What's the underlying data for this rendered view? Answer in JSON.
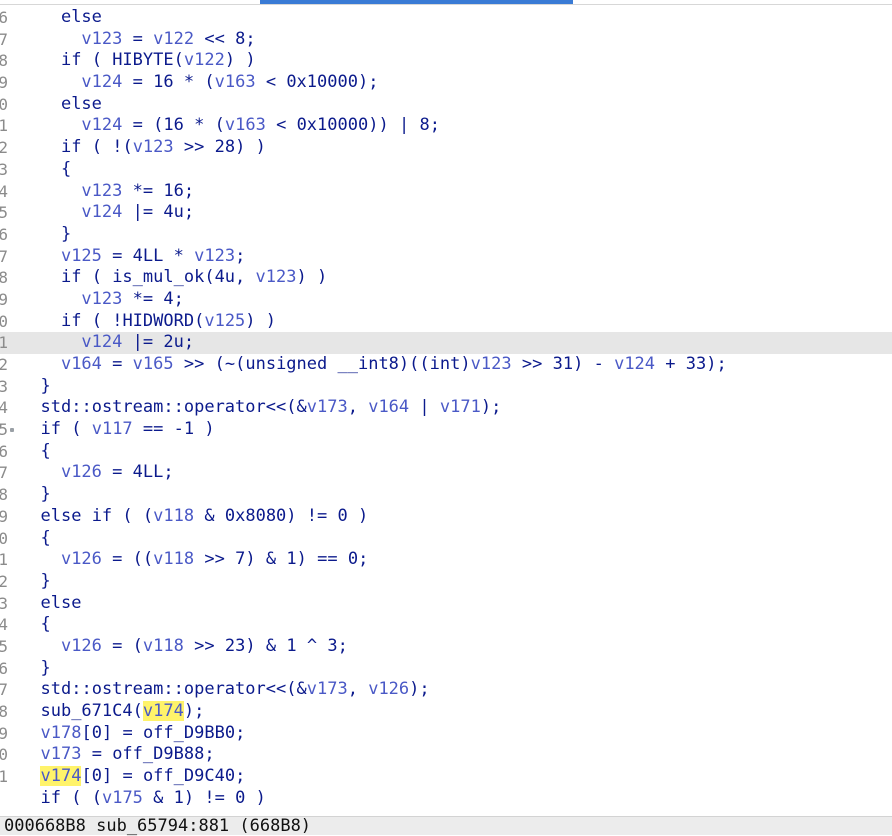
{
  "editor": {
    "line_prefixes": [
      "6",
      "7",
      "8",
      "9",
      "0",
      "1",
      "2",
      "3",
      "4",
      "5",
      "6",
      "7",
      "8",
      "9",
      "0",
      "1",
      "2",
      "3",
      "4",
      "5",
      "6",
      "7",
      "8",
      "9",
      "0",
      "1",
      "2",
      "3",
      "4",
      "5",
      "6",
      "7",
      "8",
      "9",
      "0",
      "1"
    ],
    "lines": [
      "    else",
      "      v123 = v122 << 8;",
      "    if ( HIBYTE(v122) )",
      "      v124 = 16 * (v163 < 0x10000);",
      "    else",
      "      v124 = (16 * (v163 < 0x10000)) | 8;",
      "    if ( !(v123 >> 28) )",
      "    {",
      "      v123 *= 16;",
      "      v124 |= 4u;",
      "    }",
      "    v125 = 4LL * v123;",
      "    if ( is_mul_ok(4u, v123) )",
      "      v123 *= 4;",
      "    if ( !HIDWORD(v125) )",
      "      v124 |= 2u;",
      "    v164 = v165 >> (~(unsigned __int8)((int)v123 >> 31) - v124 + 33);",
      "  }",
      "  std::ostream::operator<<(&v173, v164 | v171);",
      "  if ( v117 == -1 )",
      "  {",
      "    v126 = 4LL;",
      "  }",
      "  else if ( (v118 & 0x8080) != 0 )",
      "  {",
      "    v126 = ((v118 >> 7) & 1) == 0;",
      "  }",
      "  else",
      "  {",
      "    v126 = (v118 >> 23) & 1 ^ 3;",
      "  }",
      "  std::ostream::operator<<(&v173, v126);",
      "  sub_671C4(v174);",
      "  v178[0] = off_D9BB0;",
      "  v173 = off_D9B88;",
      "  v174[0] = off_D9C40;",
      "  if ( (v175 & 1) != 0 )"
    ],
    "highlight_token": "v174",
    "current_line_index": 15
  },
  "status_bar": {
    "text": "000668B8 sub_65794:881 (668B8)"
  }
}
